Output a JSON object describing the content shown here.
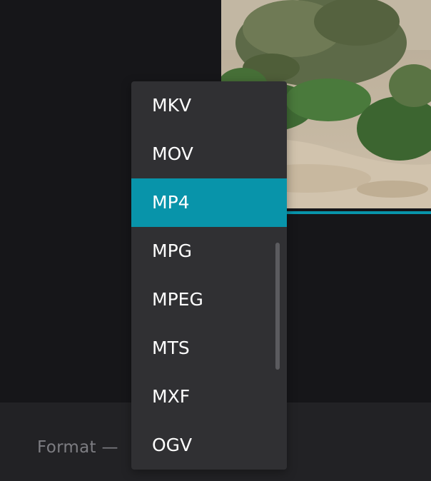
{
  "colors": {
    "background": "#161619",
    "panel": "#222225",
    "menu": "#303033",
    "accent": "#0894aa",
    "label_text": "#7d7d82"
  },
  "format_select": {
    "label": "Format —",
    "selected_value": "MP4",
    "options": [
      "MKV",
      "MOV",
      "MP4",
      "MPG",
      "MPEG",
      "MTS",
      "MXF",
      "OGV"
    ]
  },
  "icons": {
    "video_preview": "video-frame-image"
  }
}
